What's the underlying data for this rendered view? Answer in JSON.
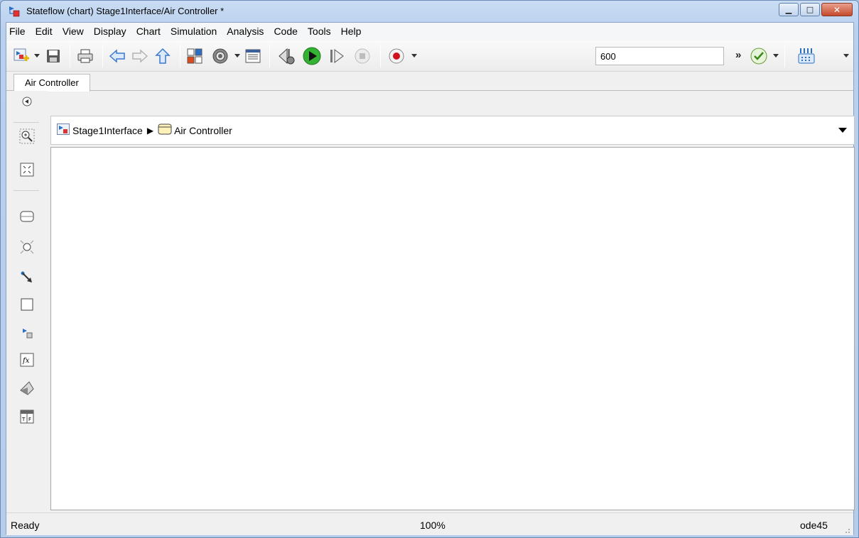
{
  "window": {
    "title": "Stateflow (chart) Stage1Interface/Air Controller *",
    "minimize_glyph": "▁",
    "maximize_glyph": "□",
    "close_glyph": "✕"
  },
  "menubar": {
    "items": [
      "File",
      "Edit",
      "View",
      "Display",
      "Chart",
      "Simulation",
      "Analysis",
      "Code",
      "Tools",
      "Help"
    ]
  },
  "toolbar": {
    "stop_time_value": "600",
    "overflow_glyph": "»",
    "icons": [
      "new-model-icon",
      "save-icon",
      "print-icon",
      "back-icon",
      "forward-icon",
      "up-icon",
      "library-browser-icon",
      "model-config-icon",
      "model-explorer-icon",
      "step-back-icon",
      "run-icon",
      "step-forward-icon",
      "stop-icon",
      "record-icon",
      "check-icon",
      "build-icon"
    ]
  },
  "tabs": [
    {
      "label": "Air Controller"
    }
  ],
  "address": {
    "model": "Stage1Interface",
    "separator": "▶",
    "chart": "Air Controller"
  },
  "leftbar": {
    "icons": [
      "hide-explorer-icon",
      "zoom-icon",
      "fit-to-view-icon",
      "state-tool-icon",
      "history-junction-icon",
      "default-transition-icon",
      "box-tool-icon",
      "simulink-function-icon",
      "matlab-function-icon",
      "graphical-function-icon",
      "truth-table-icon"
    ]
  },
  "status": {
    "left": "Ready",
    "zoom": "100%",
    "solver": "ode45"
  },
  "colors": {
    "title_bar": "#c9dcf3",
    "run_green": "#34b233",
    "record_red": "#d0141b",
    "close_red": "#c44a2c"
  }
}
